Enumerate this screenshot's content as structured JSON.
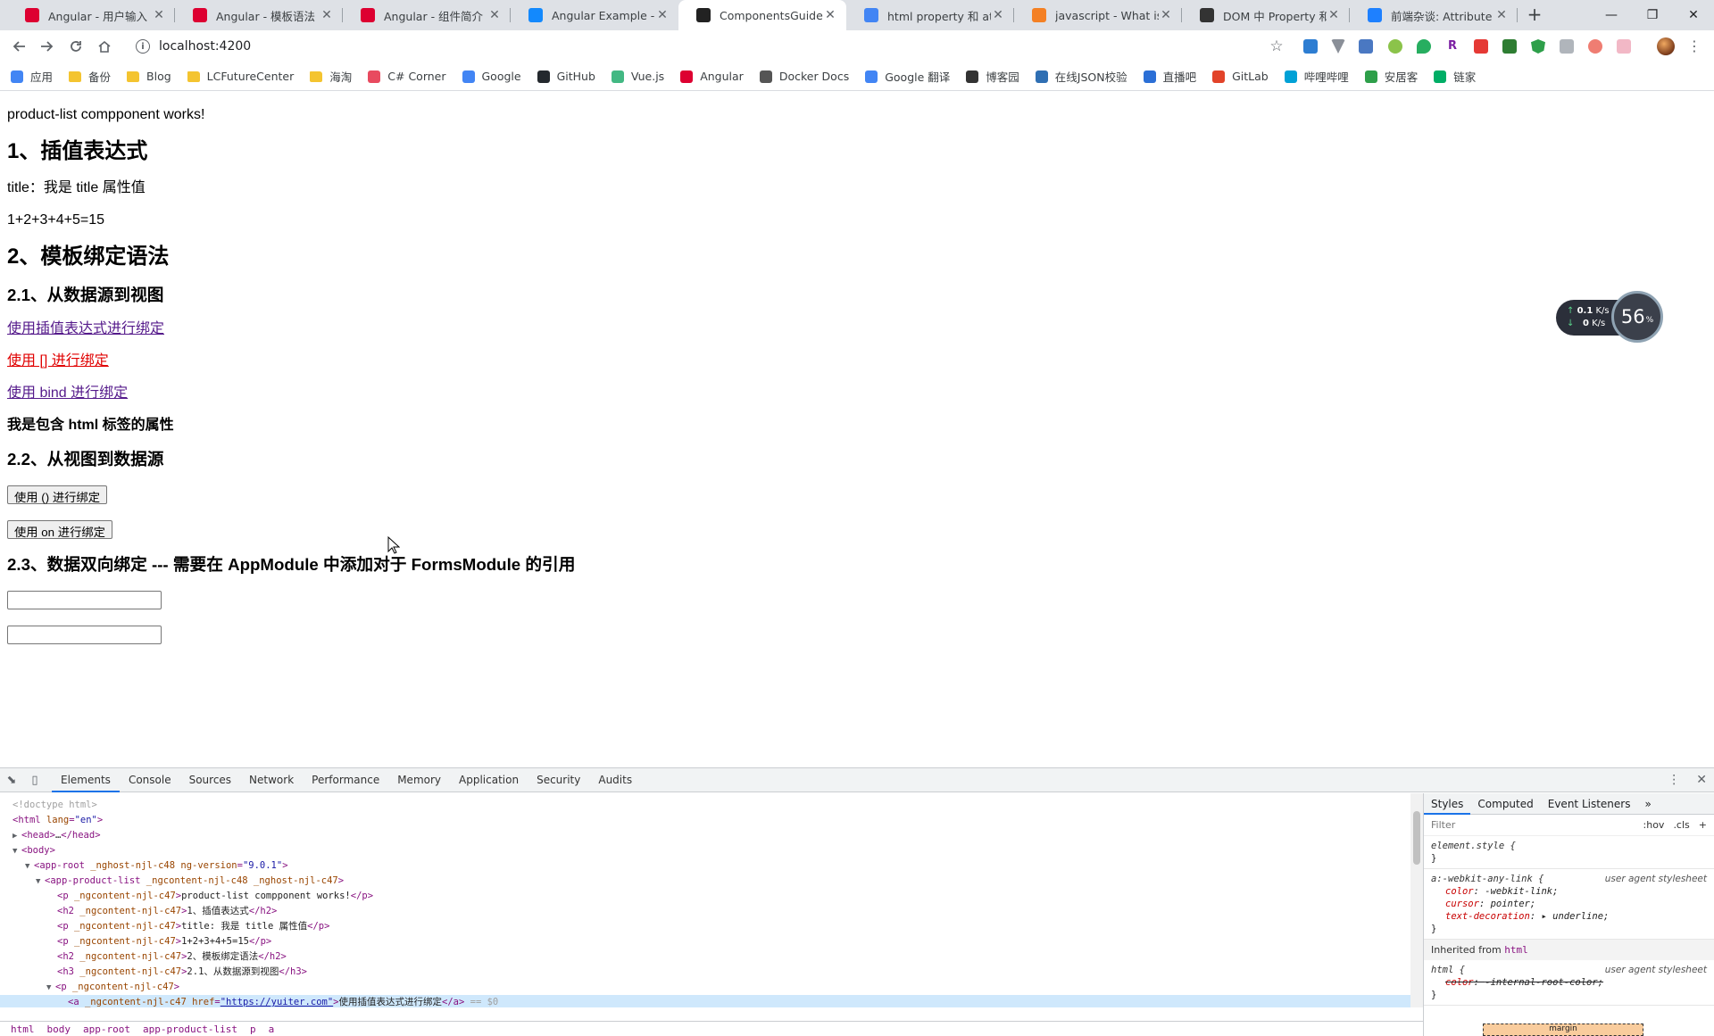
{
  "tabs": [
    {
      "title": "Angular - 用户输入",
      "favicon": "angular",
      "color": "#dd0031"
    },
    {
      "title": "Angular - 模板语法",
      "favicon": "angular",
      "color": "#dd0031"
    },
    {
      "title": "Angular - 组件简介",
      "favicon": "angular",
      "color": "#dd0031"
    },
    {
      "title": "Angular Example - Ge",
      "favicon": "stackblitz",
      "color": "#1389fd"
    },
    {
      "title": "ComponentsGuide",
      "favicon": "angular-dark",
      "color": "#222222",
      "active": true
    },
    {
      "title": "html property 和 attri",
      "favicon": "google",
      "color": "#4285f4"
    },
    {
      "title": "javascript - What is th",
      "favicon": "stackoverflow",
      "color": "#f48024"
    },
    {
      "title": "DOM 中 Property 和 A",
      "favicon": "github",
      "color": "#333333"
    },
    {
      "title": "前端杂谈: Attribute V",
      "favicon": "juejin",
      "color": "#1e80ff"
    }
  ],
  "address": {
    "url": "localhost:4200"
  },
  "bookmarks": [
    {
      "label": "应用",
      "icon": "apps-icon",
      "color": "#4285f4"
    },
    {
      "label": "备份",
      "icon": "folder-icon",
      "color": "#f4c430"
    },
    {
      "label": "Blog",
      "icon": "folder-icon",
      "color": "#f4c430"
    },
    {
      "label": "LCFutureCenter",
      "icon": "folder-icon",
      "color": "#f4c430"
    },
    {
      "label": "海淘",
      "icon": "folder-icon",
      "color": "#f4c430"
    },
    {
      "label": "C# Corner",
      "icon": "csharp-icon",
      "color": "#e84a5f"
    },
    {
      "label": "Google",
      "icon": "google-icon",
      "color": "#4285f4"
    },
    {
      "label": "GitHub",
      "icon": "github-icon",
      "color": "#24292e"
    },
    {
      "label": "Vue.js",
      "icon": "vue-icon",
      "color": "#42b883"
    },
    {
      "label": "Angular",
      "icon": "angular-icon",
      "color": "#dd0031"
    },
    {
      "label": "Docker Docs",
      "icon": "docker-icon",
      "color": "#555555"
    },
    {
      "label": "Google 翻译",
      "icon": "translate-icon",
      "color": "#4285f4"
    },
    {
      "label": "博客园",
      "icon": "cnblogs-icon",
      "color": "#333333"
    },
    {
      "label": "在线JSON校验",
      "icon": "json-icon",
      "color": "#2f6fb3"
    },
    {
      "label": "直播吧",
      "icon": "zhibo8-icon",
      "color": "#2b6fd6"
    },
    {
      "label": "GitLab",
      "icon": "gitlab-icon",
      "color": "#e24329"
    },
    {
      "label": "哔哩哔哩",
      "icon": "bilibili-icon",
      "color": "#00a1d6"
    },
    {
      "label": "安居客",
      "icon": "anjuke-icon",
      "color": "#2e9f4a"
    },
    {
      "label": "链家",
      "icon": "lianjia-icon",
      "color": "#00ae66"
    }
  ],
  "content": {
    "works": "product-list compponent works!",
    "h2_interp": "1、插值表达式",
    "title_line": "title：我是 title 属性值",
    "sum_line": "1+2+3+4+5=15",
    "h2_binding": "2、模板绑定语法",
    "h3_source_to_view": "2.1、从数据源到视图",
    "link_interp": "使用插值表达式进行绑定",
    "link_brackets": "使用 [] 进行绑定",
    "link_bind": "使用 bind 进行绑定",
    "html_attr_text": "我是包含 html 标签的属性",
    "h3_view_to_source": "2.2、从视图到数据源",
    "btn_parens": "使用 () 进行绑定",
    "btn_on": "使用 on 进行绑定",
    "h3_two_way": "2.3、数据双向绑定 --- 需要在 AppModule 中添加对于 FormsModule 的引用",
    "input1_value": "",
    "input2_value": ""
  },
  "net_widget": {
    "up": "0.1",
    "down": "0",
    "unit": "K/s",
    "percent": "56",
    "percent_unit": "%"
  },
  "devtools": {
    "tabs": [
      "Elements",
      "Console",
      "Sources",
      "Network",
      "Performance",
      "Memory",
      "Application",
      "Security",
      "Audits"
    ],
    "active_tab": "Elements",
    "breadcrumbs": [
      "html",
      "body",
      "app-root",
      "app-product-list",
      "p",
      "a"
    ],
    "styles_tabs": [
      "Styles",
      "Computed",
      "Event Listeners"
    ],
    "filter_placeholder": "Filter",
    "hov": ":hov",
    "cls": ".cls",
    "element_style": "element.style {",
    "rule1_selector": "a:-webkit-any-link {",
    "rule1_source": "user agent stylesheet",
    "rule1_props": [
      {
        "name": "color",
        "value": "-webkit-link;"
      },
      {
        "name": "cursor",
        "value": "pointer;"
      },
      {
        "name": "text-decoration",
        "value": "▸ underline;"
      }
    ],
    "inherited_label": "Inherited from",
    "inherited_tag": "html",
    "rule2_selector": "html {",
    "rule2_source": "user agent stylesheet",
    "rule2_prop_name": "color",
    "rule2_prop_value": "-internal-root-color;",
    "close_brace": "}",
    "margin_label": "margin"
  }
}
